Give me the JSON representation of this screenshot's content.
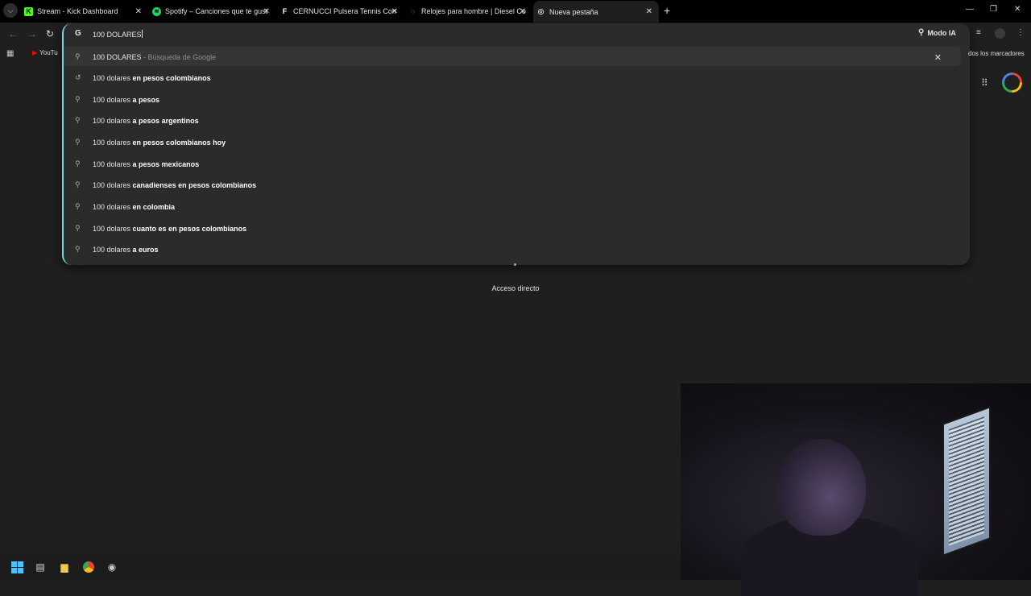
{
  "tabs": [
    {
      "title": "Stream - Kick Dashboard",
      "favicon": "kick-icon",
      "active": false
    },
    {
      "title": "Spotify – Canciones que te gust",
      "favicon": "spotify-icon",
      "active": false
    },
    {
      "title": "CERNUCCI Pulsera Tennis Con",
      "favicon": "cernucci-icon",
      "active": false
    },
    {
      "title": "Relojes para hombre | Diesel Co",
      "favicon": "diesel-icon",
      "active": false
    },
    {
      "title": "Nueva pestaña",
      "favicon": "chrome-icon",
      "active": true
    }
  ],
  "omnibox": {
    "value": "100 DOLARES",
    "first_suggestion": {
      "text": "100 DOLARES",
      "desc": " - Búsqueda de Google"
    },
    "suggestions": [
      {
        "base": "100 dolares ",
        "bold": "en pesos colombianos",
        "icon": "history-icon"
      },
      {
        "base": "100 dolares ",
        "bold": "a pesos",
        "icon": "search-icon"
      },
      {
        "base": "100 dolares ",
        "bold": "a pesos argentinos",
        "icon": "search-icon"
      },
      {
        "base": "100 dolares ",
        "bold": "en pesos colombianos hoy",
        "icon": "search-icon"
      },
      {
        "base": "100 dolares ",
        "bold": "a pesos mexicanos",
        "icon": "search-icon"
      },
      {
        "base": "100 dolares ",
        "bold": "canadienses en pesos colombianos",
        "icon": "search-icon"
      },
      {
        "base": "100 dolares ",
        "bold": "en colombia",
        "icon": "search-icon"
      },
      {
        "base": "100 dolares ",
        "bold": "cuanto es en pesos colombianos",
        "icon": "search-icon"
      },
      {
        "base": "100 dolares ",
        "bold": "a euros",
        "icon": "search-icon"
      }
    ]
  },
  "toolbar": {
    "modo_ia": "Modo IA"
  },
  "bookmarks": {
    "youtube": "YouTu",
    "all": "dos los marcadores"
  },
  "ntp": {
    "shortcut_label": "Acceso directo"
  },
  "colors": {
    "accent": "#7dd3e0",
    "background": "#1f1f1f"
  }
}
